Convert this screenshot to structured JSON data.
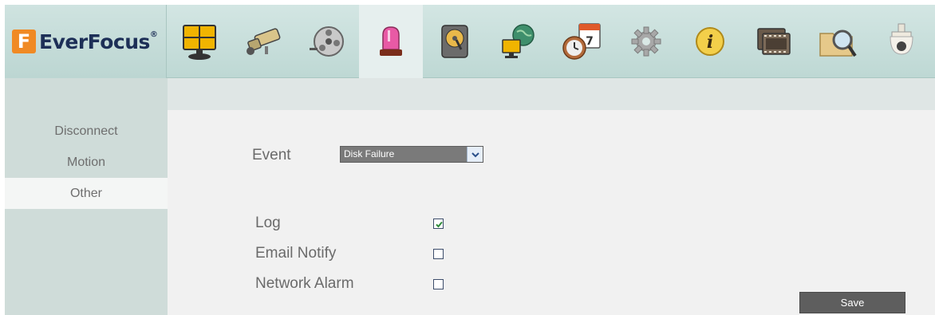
{
  "brand": {
    "name": "EverFocus",
    "registered": "®"
  },
  "toolbar": {
    "items": [
      {
        "icon": "live-view-icon"
      },
      {
        "icon": "camera-icon"
      },
      {
        "icon": "record-icon"
      },
      {
        "icon": "alarm-event-icon",
        "active": true
      },
      {
        "icon": "hard-disk-icon"
      },
      {
        "icon": "network-icon"
      },
      {
        "icon": "schedule-icon"
      },
      {
        "icon": "settings-gear-icon"
      },
      {
        "icon": "info-icon"
      },
      {
        "icon": "playback-icon"
      },
      {
        "icon": "search-icon"
      },
      {
        "icon": "ptz-dome-icon"
      }
    ]
  },
  "sidebar": {
    "items": [
      {
        "label": "Disconnect"
      },
      {
        "label": "Motion"
      },
      {
        "label": "Other",
        "active": true
      }
    ]
  },
  "form": {
    "event_label": "Event",
    "event_value": "Disk Failure",
    "options": [
      {
        "label": "Log",
        "checked": true
      },
      {
        "label": "Email Notify",
        "checked": false
      },
      {
        "label": "Network Alarm",
        "checked": false
      }
    ],
    "save_label": "Save"
  },
  "colors": {
    "accent": "#f08a24",
    "brand_text": "#1d2f57",
    "header_bg": "#c8dfdb",
    "button": "#5e5e5e"
  }
}
